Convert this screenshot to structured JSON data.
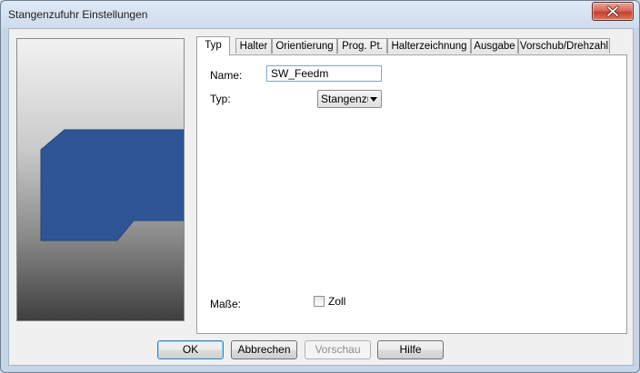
{
  "window": {
    "title": "Stangenzufuhr Einstellungen"
  },
  "tabs": [
    "Typ",
    "Halter",
    "Orientierung",
    "Prog. Pt.",
    "Halterzeichnung",
    "Ausgabe",
    "Vorschub/Drehzahl"
  ],
  "active_tab": "Typ",
  "form": {
    "name_label": "Name:",
    "name_value": "SW_Feedm",
    "type_label": "Typ:",
    "type_value": "Stangenzu",
    "dims_label": "Maße:",
    "inch_label": "Zoll",
    "inch_checked": false
  },
  "buttons": {
    "ok": "OK",
    "cancel": "Abbrechen",
    "preview": "Vorschau",
    "help": "Hilfe"
  },
  "colors": {
    "part": "#2f5597",
    "close": "#c6402f"
  }
}
